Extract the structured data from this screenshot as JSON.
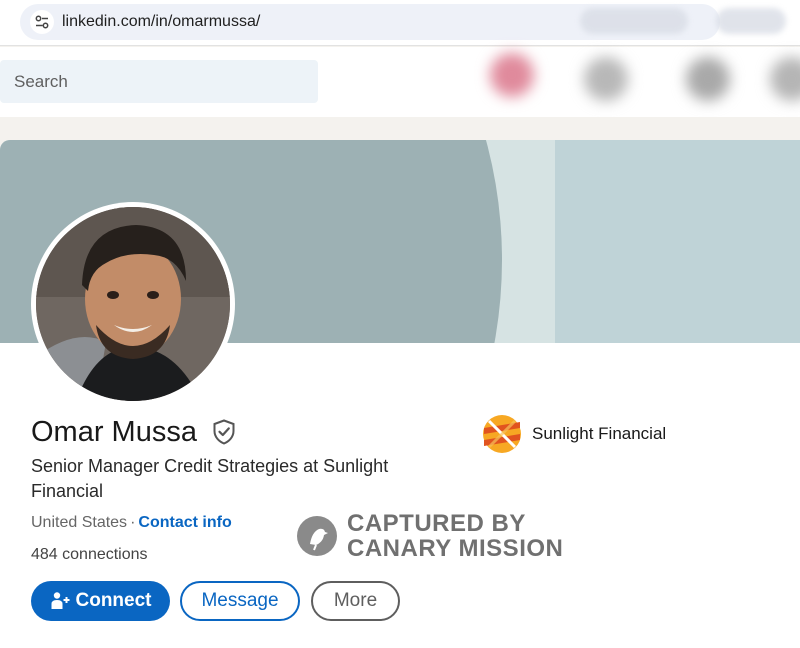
{
  "browser": {
    "url": "linkedin.com/in/omarmussa/"
  },
  "nav": {
    "search_placeholder": "Search"
  },
  "profile": {
    "name": "Omar Mussa",
    "headline": "Senior Manager Credit Strategies at Sunlight Financial",
    "location": "United States",
    "separator": "·",
    "contact_info": "Contact info",
    "connections": "484 connections",
    "company": "Sunlight Financial"
  },
  "actions": {
    "connect_label": "Connect",
    "message_label": "Message",
    "more_label": "More"
  },
  "watermark": {
    "line1": "CAPTURED BY",
    "line2": "CANARY MISSION"
  },
  "icons": {
    "site_settings": "tune-icon",
    "verified": "verified-shield-icon",
    "connect": "add-person-icon",
    "company_logo": "sunlight-financial-logo",
    "watermark": "canary-bird-icon"
  },
  "colors": {
    "brand_blue": "#0a66c2",
    "banner_dark": "#9db1b4",
    "banner_light": "#d6e3e3",
    "banner_right": "#bfd3d7",
    "page_bg": "#f4f2ee"
  }
}
